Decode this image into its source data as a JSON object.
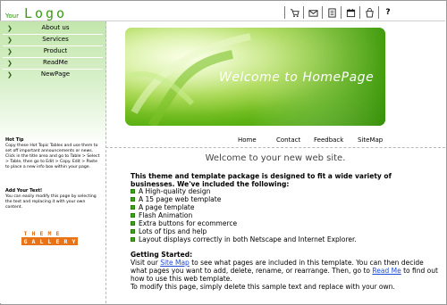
{
  "header": {
    "logo_prefix": "Your",
    "logo_word": "Logo",
    "toolbar_icons": [
      "cart-icon",
      "mail-icon",
      "document-icon",
      "calendar-icon",
      "bag-icon",
      "help-icon"
    ],
    "help_glyph": "?"
  },
  "sidebar": {
    "items": [
      {
        "label": "About us"
      },
      {
        "label": "Services"
      },
      {
        "label": "Product"
      },
      {
        "label": "ReadMe"
      },
      {
        "label": "NewPage"
      }
    ],
    "hot_tip_title": "Hot Tip",
    "hot_tip_body": "Copy these Hot Topic Tables and use them to set off important announcements or news. Click in the title area and go to Table > Select > Table, then go to Edit > Copy. Edit > Paste to place a new info box within your page.",
    "add_text_title": "Add Your Text!",
    "add_text_body": "You can easily modify this page by selecting the text and replacing it with your own content.",
    "brand_top": "THEME",
    "brand_bottom": "GALLERY"
  },
  "banner": {
    "title": "Welcome to HomePage"
  },
  "topnav": [
    {
      "label": "Home"
    },
    {
      "label": "Contact"
    },
    {
      "label": "Feedback"
    },
    {
      "label": "SiteMap"
    }
  ],
  "content": {
    "heading": "Welcome to your new web site.",
    "intro": "This theme and template package is designed to fit a wide variety of businesses. We've included the following:",
    "features": [
      "A High-quality design",
      "A 15 page web template",
      "A page template",
      "Flash Animation",
      "Extra buttons for ecommerce",
      "Lots of tips and help",
      "Layout displays correctly in both Netscape and Internet Explorer."
    ],
    "gs_title": "Getting Started:",
    "gs_1": "Visit our ",
    "gs_link1": "Site Map",
    "gs_2": " to see what pages are included in this template. You can then decide what pages you want to add, delete, rename, or rearrange. Then, go to ",
    "gs_link2": "Read Me",
    "gs_3": " to find out how to use this web template.",
    "gs_4": "To modify this page, simply delete this sample text and replace with your own."
  },
  "colors": {
    "accent": "#3c9c12",
    "sidebar": "#c3e6ad",
    "brand_orange": "#e8741a",
    "link": "#1a4bd6"
  }
}
